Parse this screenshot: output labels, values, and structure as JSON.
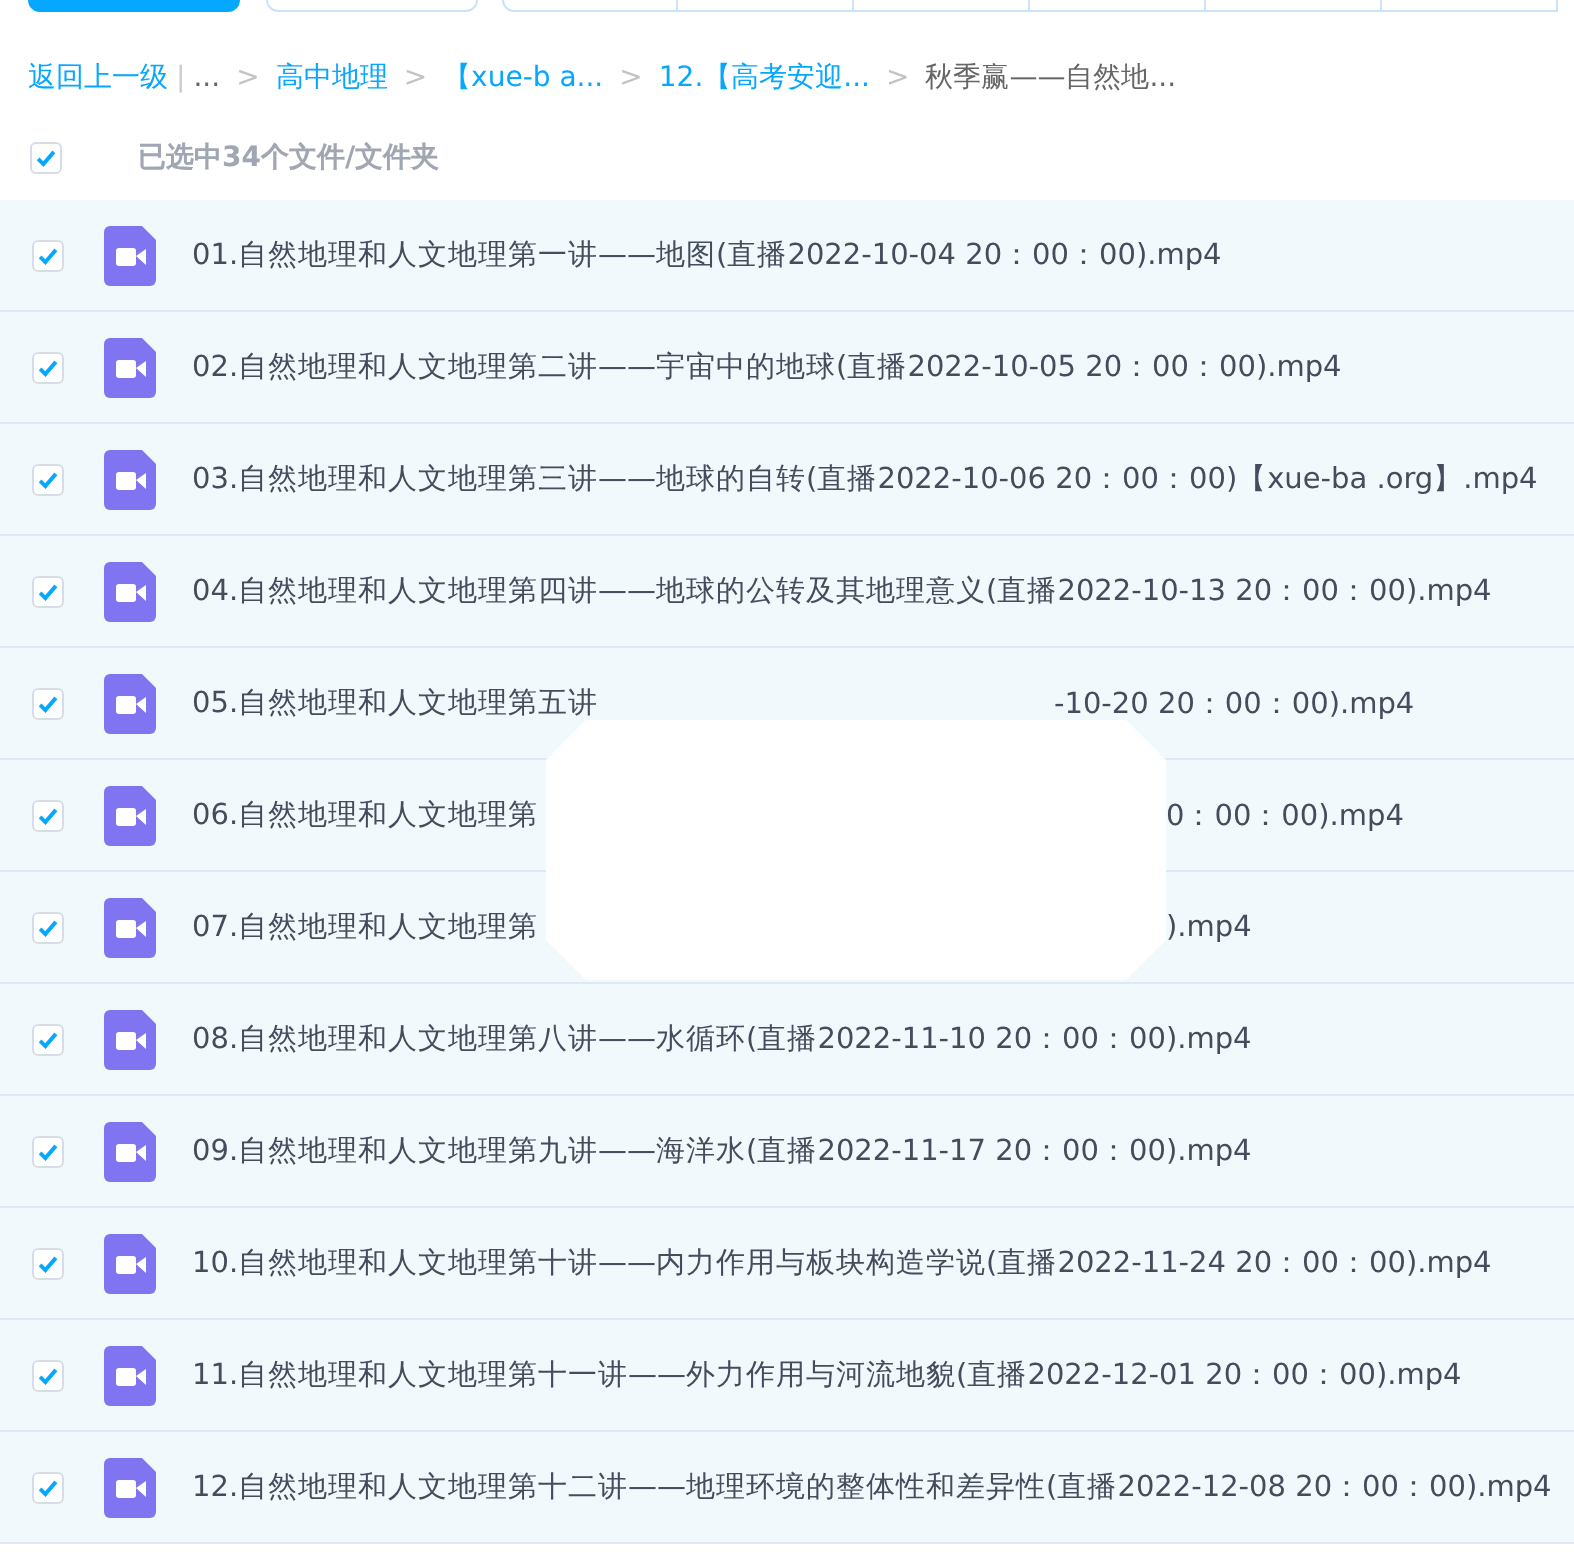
{
  "top_buttons": [
    {
      "kind": "primary"
    },
    {
      "kind": "outline"
    },
    {
      "kind": "segment"
    },
    {
      "kind": "segment"
    },
    {
      "kind": "segment"
    },
    {
      "kind": "segment"
    },
    {
      "kind": "segment"
    },
    {
      "kind": "segment"
    }
  ],
  "breadcrumb": {
    "back": "返回上一级",
    "divider": "|",
    "items": [
      {
        "label": "...",
        "kind": "ellipsis"
      },
      {
        "label": "高中地理",
        "kind": "link"
      },
      {
        "label": "【xue-b a...",
        "kind": "link"
      },
      {
        "label": "12.【高考安迎...",
        "kind": "link"
      },
      {
        "label": "秋季赢——自然地...",
        "kind": "current"
      }
    ],
    "separator": ">"
  },
  "select_all": {
    "checked": true,
    "label": "已选中34个文件/文件夹"
  },
  "files": [
    {
      "name": "01.自然地理和人文地理第一讲——地图(直播2022-10-04 20：00：00).mp4",
      "checked": true
    },
    {
      "name": "02.自然地理和人文地理第二讲——宇宙中的地球(直播2022-10-05 20：00：00).mp4",
      "checked": true
    },
    {
      "name": "03.自然地理和人文地理第三讲——地球的自转(直播2022-10-06 20：00：00)【xue-ba .org】.mp4",
      "checked": true
    },
    {
      "name": "04.自然地理和人文地理第四讲——地球的公转及其地理意义(直播2022-10-13 20：00：00).mp4",
      "checked": true
    },
    {
      "name": "05.自然地理和人文地理第五讲",
      "tail": "-10-20 20：00：00).mp4",
      "checked": true
    },
    {
      "name": "06.自然地理和人文地理第",
      "tail": "0：00：00).mp4",
      "checked": true
    },
    {
      "name": "07.自然地理和人文地理第",
      "tail": ").mp4",
      "checked": true
    },
    {
      "name": "08.自然地理和人文地理第八讲——水循环(直播2022-11-10 20：00：00).mp4",
      "checked": true
    },
    {
      "name": "09.自然地理和人文地理第九讲——海洋水(直播2022-11-17 20：00：00).mp4",
      "checked": true
    },
    {
      "name": "10.自然地理和人文地理第十讲——内力作用与板块构造学说(直播2022-11-24 20：00：00).mp4",
      "checked": true
    },
    {
      "name": "11.自然地理和人文地理第十一讲——外力作用与河流地貌(直播2022-12-01 20：00：00).mp4",
      "checked": true
    },
    {
      "name": "12.自然地理和人文地理第十二讲——地理环境的整体性和差异性(直播2022-12-08 20：00：00).mp4",
      "checked": true
    }
  ]
}
